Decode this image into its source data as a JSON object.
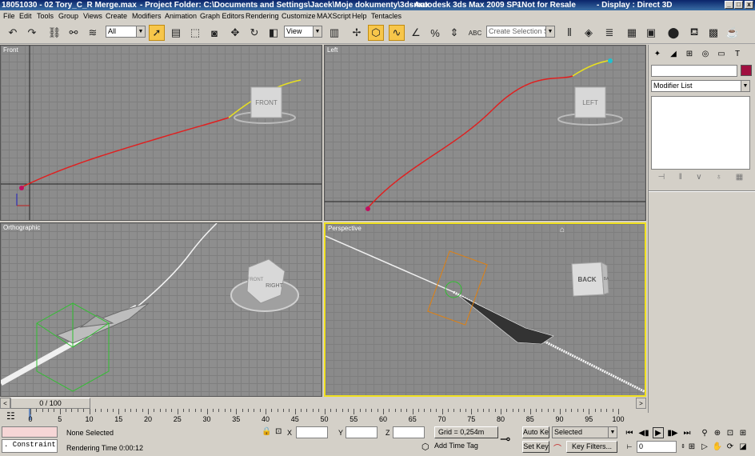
{
  "title": {
    "scene": "18051030 - 02 Tory_C_R Merge.max",
    "project": "- Project Folder: C:\\Documents and Settings\\Jacek\\Moje dokumenty\\3dsmax",
    "app": "- Autodesk 3ds Max  2009 SP1",
    "license": "- Not for Resale",
    "display": "- Display : Direct 3D",
    "min": "_",
    "max": "□",
    "close": "x"
  },
  "menu": [
    "File",
    "Edit",
    "Tools",
    "Group",
    "Views",
    "Create",
    "Modifiers",
    "Animation",
    "Graph Editors",
    "Rendering",
    "Customize",
    "MAXScript",
    "Help",
    "Tentacles"
  ],
  "toolbar": {
    "filter": "All",
    "refcoord": "View",
    "selset_placeholder": "Create Selection Set",
    "abc": "ABC"
  },
  "viewports": [
    {
      "label": "Front",
      "cube": "FRONT"
    },
    {
      "label": "Left",
      "cube": "LEFT"
    },
    {
      "label": "Orthographic",
      "cube_a": "RIGHT",
      "cube_b": "FRONT"
    },
    {
      "label": "Perspective",
      "cube": "BACK",
      "cube_side": "BA"
    }
  ],
  "panel": {
    "modifier_list": "Modifier List"
  },
  "timeline": {
    "frame": "0 / 100"
  },
  "ticks": [
    0,
    5,
    10,
    15,
    20,
    25,
    30,
    35,
    40,
    45,
    50,
    55,
    60,
    65,
    70,
    75,
    80,
    85,
    90,
    95,
    100
  ],
  "status": {
    "constraint": ". Constraint",
    "selection": "None Selected",
    "render_time": "Rendering Time  0:00:12",
    "x_label": "X",
    "y_label": "Y",
    "z_label": "Z",
    "grid": "Grid = 0,254m",
    "add_time_tag": "Add Time Tag",
    "auto_key": "Auto Key",
    "set_key": "Set Key",
    "selected": "Selected",
    "key_filters": "Key Filters...",
    "frame_value": "0"
  }
}
